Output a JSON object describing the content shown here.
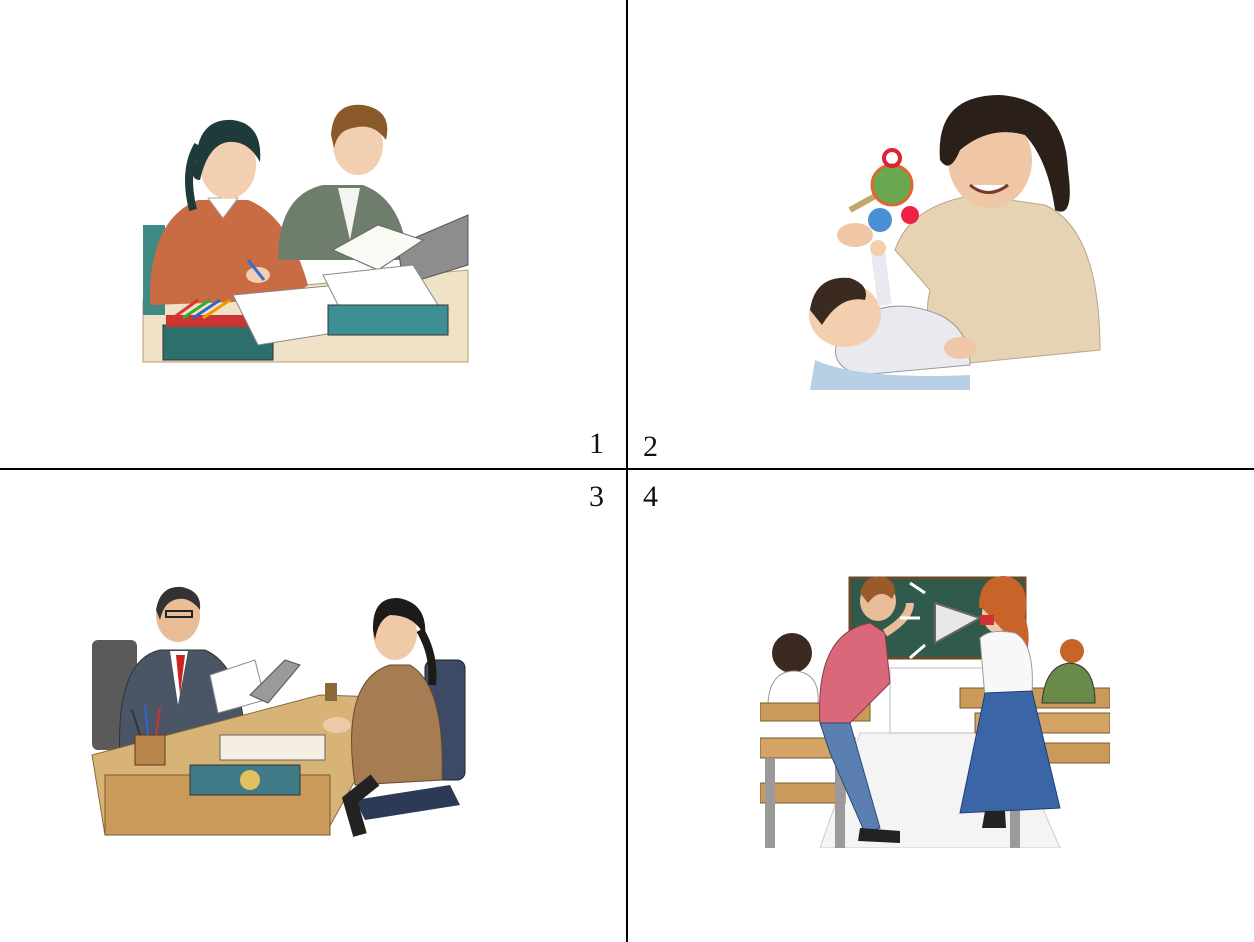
{
  "panels": [
    {
      "number": "1",
      "scene": "studying-illustration"
    },
    {
      "number": "2",
      "scene": "playing-with-baby-illustration"
    },
    {
      "number": "3",
      "scene": "office-meeting-illustration"
    },
    {
      "number": "4",
      "scene": "classroom-megaphone-illustration"
    }
  ],
  "colors": {
    "divider": "#000000",
    "background": "#ffffff",
    "sweater_orange": "#c96b43",
    "jacket_green": "#6f7d6c",
    "beige_sweater": "#e5d3b3",
    "suit_gray": "#4a5566",
    "pink_shirt": "#d9687a",
    "chalkboard": "#2f5a4c",
    "desk_wood": "#c99a5a"
  }
}
